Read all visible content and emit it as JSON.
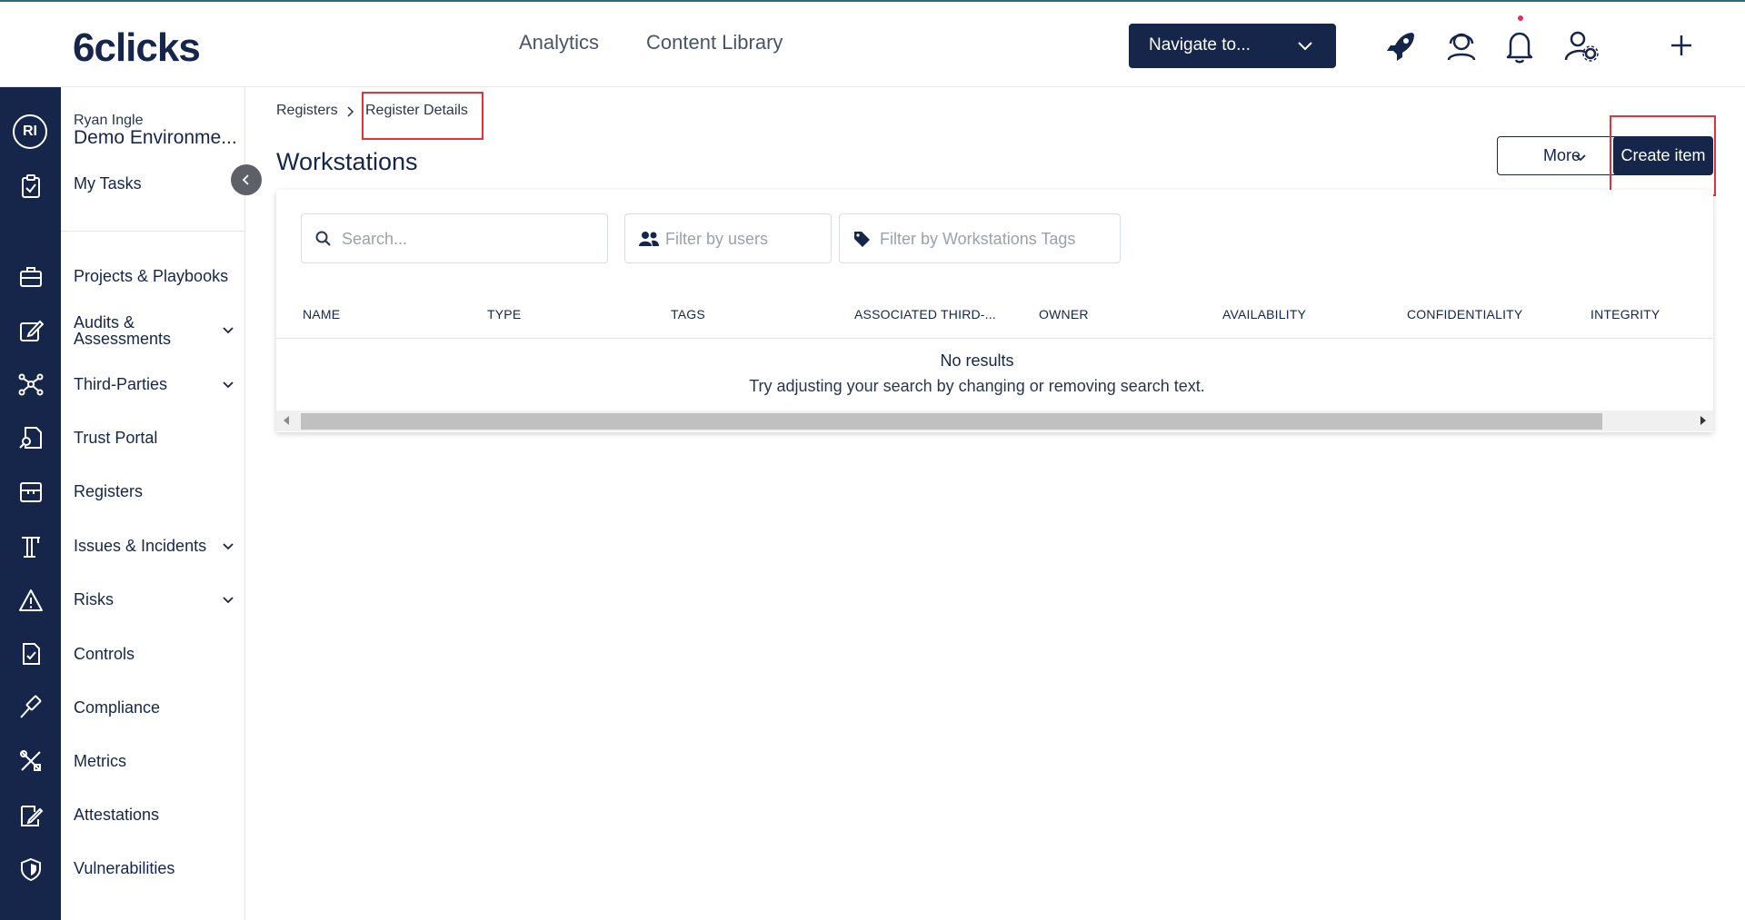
{
  "header": {
    "logo": "6clicks",
    "nav": [
      "Analytics",
      "Content Library"
    ],
    "navigate_label": "Navigate to...",
    "icons": [
      "rocket-icon",
      "support-agent-icon",
      "bell-icon",
      "user-settings-icon",
      "plus-icon"
    ]
  },
  "user": {
    "initials": "RI",
    "name": "Ryan Ingle",
    "environment": "Demo Environme..."
  },
  "sidebar": {
    "items": [
      {
        "label": "My Tasks",
        "icon": "clipboard-check-icon"
      },
      {
        "label": "Projects & Playbooks",
        "icon": "briefcase-icon"
      },
      {
        "label": "Audits &\nAssessments",
        "icon": "edit-icon"
      },
      {
        "label": "Third-Parties",
        "icon": "network-icon"
      },
      {
        "label": "Trust Portal",
        "icon": "document-search-icon"
      },
      {
        "label": "Registers",
        "icon": "archive-icon"
      },
      {
        "label": "Issues & Incidents",
        "icon": "crane-icon"
      },
      {
        "label": "Risks",
        "icon": "warning-icon"
      },
      {
        "label": "Controls",
        "icon": "document-check-icon"
      },
      {
        "label": "Compliance",
        "icon": "gavel-icon"
      },
      {
        "label": "Metrics",
        "icon": "tools-icon"
      },
      {
        "label": "Attestations",
        "icon": "signature-icon"
      },
      {
        "label": "Vulnerabilities",
        "icon": "shield-icon"
      }
    ]
  },
  "breadcrumb": {
    "parent": "Registers",
    "current": "Register Details"
  },
  "page": {
    "title": "Workstations",
    "more_label": "More",
    "create_label": "Create item"
  },
  "filters": {
    "search_placeholder": "Search...",
    "users_placeholder": "Filter by users",
    "tags_placeholder": "Filter by Workstations Tags"
  },
  "table": {
    "columns": [
      "NAME",
      "TYPE",
      "TAGS",
      "ASSOCIATED THIRD-...",
      "OWNER",
      "AVAILABILITY",
      "CONFIDENTIALITY",
      "INTEGRITY"
    ],
    "empty_title": "No results",
    "empty_message": "Try adjusting your search by changing or removing search text."
  },
  "colors": {
    "navy": "#15264a",
    "highlight": "#e2333b"
  }
}
